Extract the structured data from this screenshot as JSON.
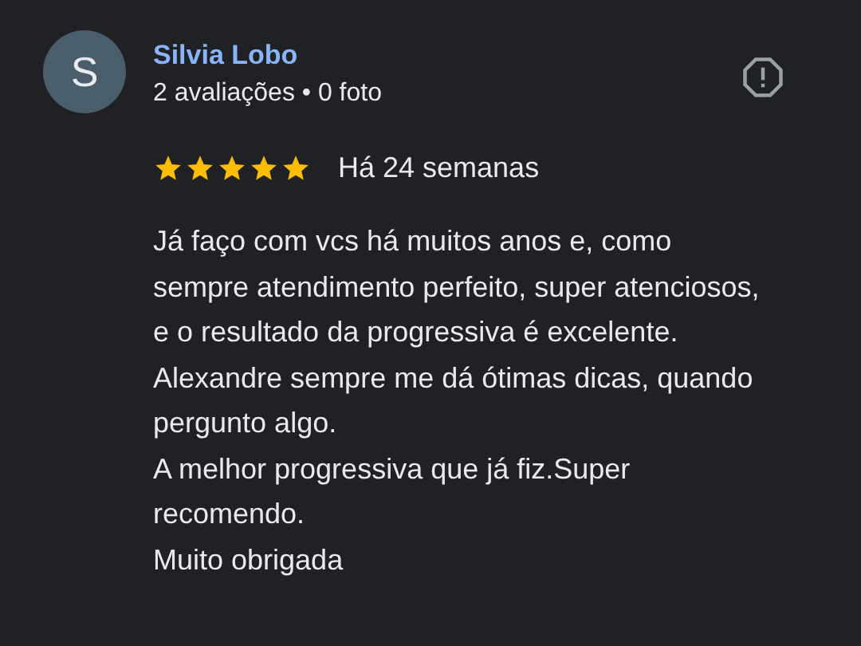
{
  "review": {
    "avatar_letter": "S",
    "author": "Silvia Lobo",
    "author_meta": "2 avaliações • 0 foto",
    "stars": 5,
    "time": "Há 24 semanas",
    "paragraphs": [
      "Já faço com vcs há muitos anos e, como sempre atendimento perfeito, super atenciosos, e o resultado da progressiva é excelente.",
      "Alexandre sempre me dá ótimas dicas, quando pergunto algo.",
      "A melhor progressiva que já fiz.Super recomendo.",
      "Muito obrigada"
    ]
  }
}
